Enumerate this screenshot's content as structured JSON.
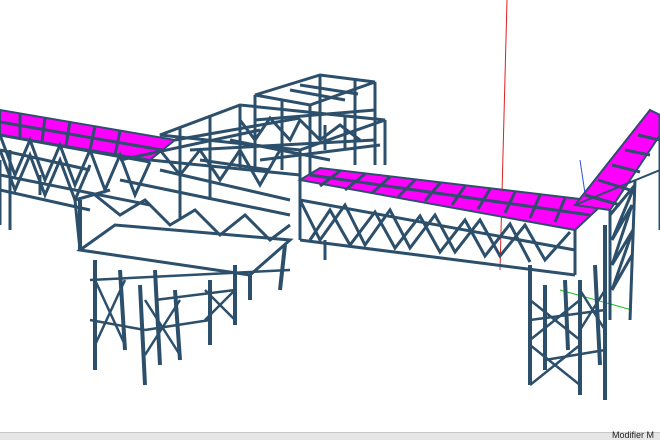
{
  "viewport": {
    "background": "#ffffff",
    "steel_color": "#2c4f6b",
    "deck_color": "#ff00ff",
    "axis_colors": {
      "x": "#e02020",
      "y": "#20c020",
      "z": "#2020e0"
    }
  },
  "status_bar": {
    "text": "Modifier M"
  }
}
